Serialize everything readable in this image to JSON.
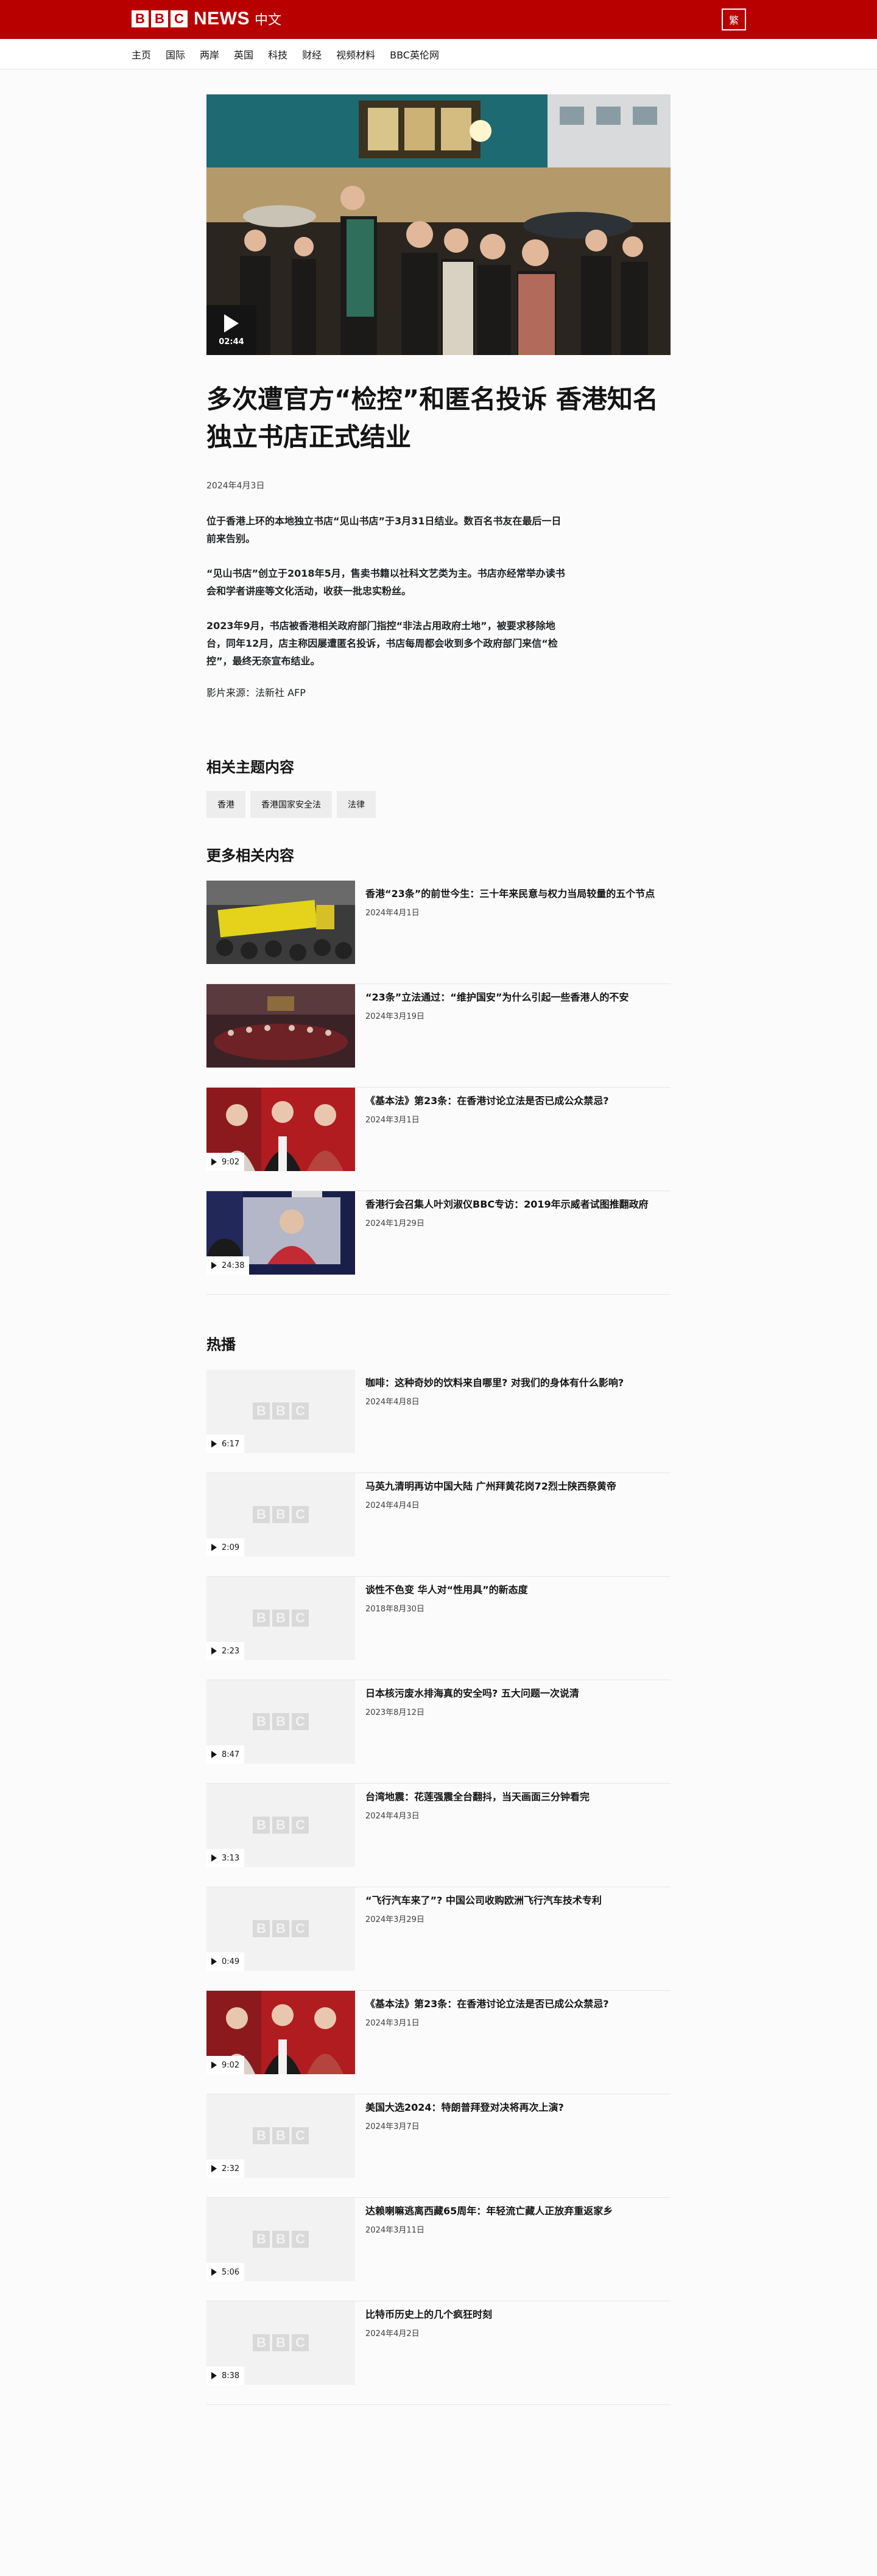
{
  "header": {
    "logo_letters": [
      "B",
      "B",
      "C"
    ],
    "logo_news": "NEWS",
    "logo_lang": "中文",
    "trad_button": "繁",
    "brand_red": "#b80000"
  },
  "nav": {
    "items": [
      "主页",
      "国际",
      "两岸",
      "英国",
      "科技",
      "财经",
      "视频材料",
      "BBC英伦网"
    ]
  },
  "article": {
    "video_duration": "02:44",
    "title": "多次遭官方“检控”和匿名投诉 香港知名独立书店正式结业",
    "date": "2024年4月3日",
    "paragraphs": [
      "位于香港上环的本地独立书店“见山书店”于3月31日结业。数百名书友在最后一日前来告别。",
      "“见山书店”创立于2018年5月，售卖书籍以社科文艺类为主。书店亦经常举办读书会和学者讲座等文化活动，收获一批忠实粉丝。",
      "2023年9月，书店被香港相关政府部门指控“非法占用政府土地”，被要求移除地台，同年12月，店主称因屡遭匿名投诉，书店每周都会收到多个政府部门来信“检控”，最终无奈宣布结业。",
      "影片来源：法新社 AFP"
    ]
  },
  "related_topics": {
    "heading": "相关主题内容",
    "tags": [
      "香港",
      "香港国家安全法",
      "法律"
    ]
  },
  "more_related": {
    "heading": "更多相关内容",
    "items": [
      {
        "title": "香港“23条”的前世今生：三十年来民意与权力当局较量的五个节点",
        "date": "2024年4月1日",
        "duration": "",
        "thumb": "protest-photo"
      },
      {
        "title": "“23条”立法通过：“维护国安”为什么引起一些香港人的不安",
        "date": "2024年3月19日",
        "duration": "",
        "thumb": "legco-photo"
      },
      {
        "title": "《基本法》第23条：在香港讨论立法是否已成公众禁忌?",
        "date": "2024年3月1日",
        "duration": "9:02",
        "thumb": "three-people-photo"
      },
      {
        "title": "香港行会召集人叶刘淑仪BBC专访：2019年示威者试图推翻政府",
        "date": "2024年1月29日",
        "duration": "24:38",
        "thumb": "interview-photo"
      }
    ]
  },
  "popular": {
    "heading": "热播",
    "items": [
      {
        "title": "咖啡：这种奇妙的饮料来自哪里? 对我们的身体有什么影响?",
        "date": "2024年4月8日",
        "duration": "6:17",
        "thumb": "placeholder"
      },
      {
        "title": "马英九清明再访中国大陆 广州拜黄花岗72烈士陕西祭黄帝",
        "date": "2024年4月4日",
        "duration": "2:09",
        "thumb": "placeholder"
      },
      {
        "title": "谈性不色变 华人对“性用具”的新态度",
        "date": "2018年8月30日",
        "duration": "2:23",
        "thumb": "placeholder"
      },
      {
        "title": "日本核污废水排海真的安全吗? 五大问题一次说清",
        "date": "2023年8月12日",
        "duration": "8:47",
        "thumb": "placeholder"
      },
      {
        "title": "台湾地震：花莲强震全台翻抖，当天画面三分钟看完",
        "date": "2024年4月3日",
        "duration": "3:13",
        "thumb": "placeholder"
      },
      {
        "title": "“飞行汽车来了”? 中国公司收购欧洲飞行汽车技术专利",
        "date": "2024年3月29日",
        "duration": "0:49",
        "thumb": "placeholder"
      },
      {
        "title": "《基本法》第23条：在香港讨论立法是否已成公众禁忌?",
        "date": "2024年3月1日",
        "duration": "9:02",
        "thumb": "three-people-photo"
      },
      {
        "title": "美国大选2024：特朗普拜登对决将再次上演?",
        "date": "2024年3月7日",
        "duration": "2:32",
        "thumb": "placeholder"
      },
      {
        "title": "达赖喇嘛逃离西藏65周年：年轻流亡藏人正放弃重返家乡",
        "date": "2024年3月11日",
        "duration": "5:06",
        "thumb": "placeholder"
      },
      {
        "title": "比特币历史上的几个疯狂时刻",
        "date": "2024年4月2日",
        "duration": "8:38",
        "thumb": "placeholder"
      }
    ]
  }
}
